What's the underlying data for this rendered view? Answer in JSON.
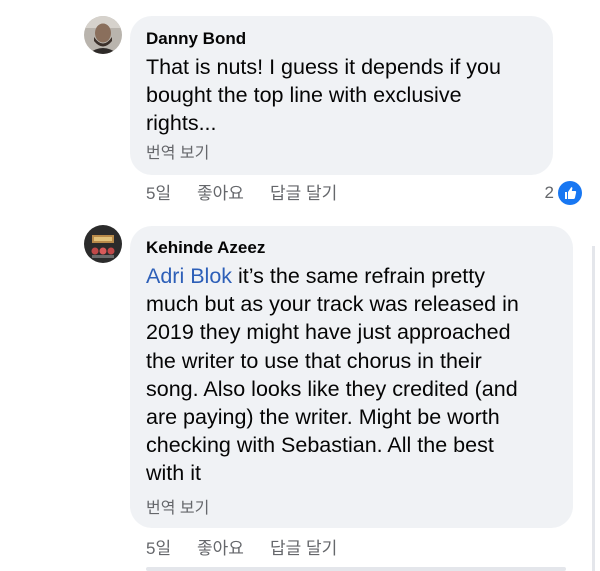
{
  "comments": [
    {
      "author": "Danny Bond",
      "text_lines": [
        "That is nuts! I guess it depends if you",
        "bought the top line with exclusive",
        "rights..."
      ],
      "translate_label": "번역 보기",
      "time": "5일",
      "like_label": "좋아요",
      "reply_label": "답글 달기",
      "reaction_count": "2",
      "reaction_icon": "thumbs-up-icon"
    },
    {
      "author": "Kehinde Azeez",
      "mention": "Adri Blok",
      "text_first_rest": " it’s the same refrain pretty",
      "text_lines": [
        "much but as your track was released in",
        "2019 they might have just approached",
        "the writer to use that chorus in their",
        "song. Also looks like they credited (and",
        "are paying) the writer. Might be worth",
        "checking with Sebastian. All the best",
        "with it"
      ],
      "translate_label": "번역 보기",
      "time": "5일",
      "like_label": "좋아요",
      "reply_label": "답글 달기"
    }
  ],
  "colors": {
    "bubble": "#f0f2f5",
    "mention": "#2d5fb8",
    "meta": "#65676b",
    "like_badge": "#1877f2"
  }
}
